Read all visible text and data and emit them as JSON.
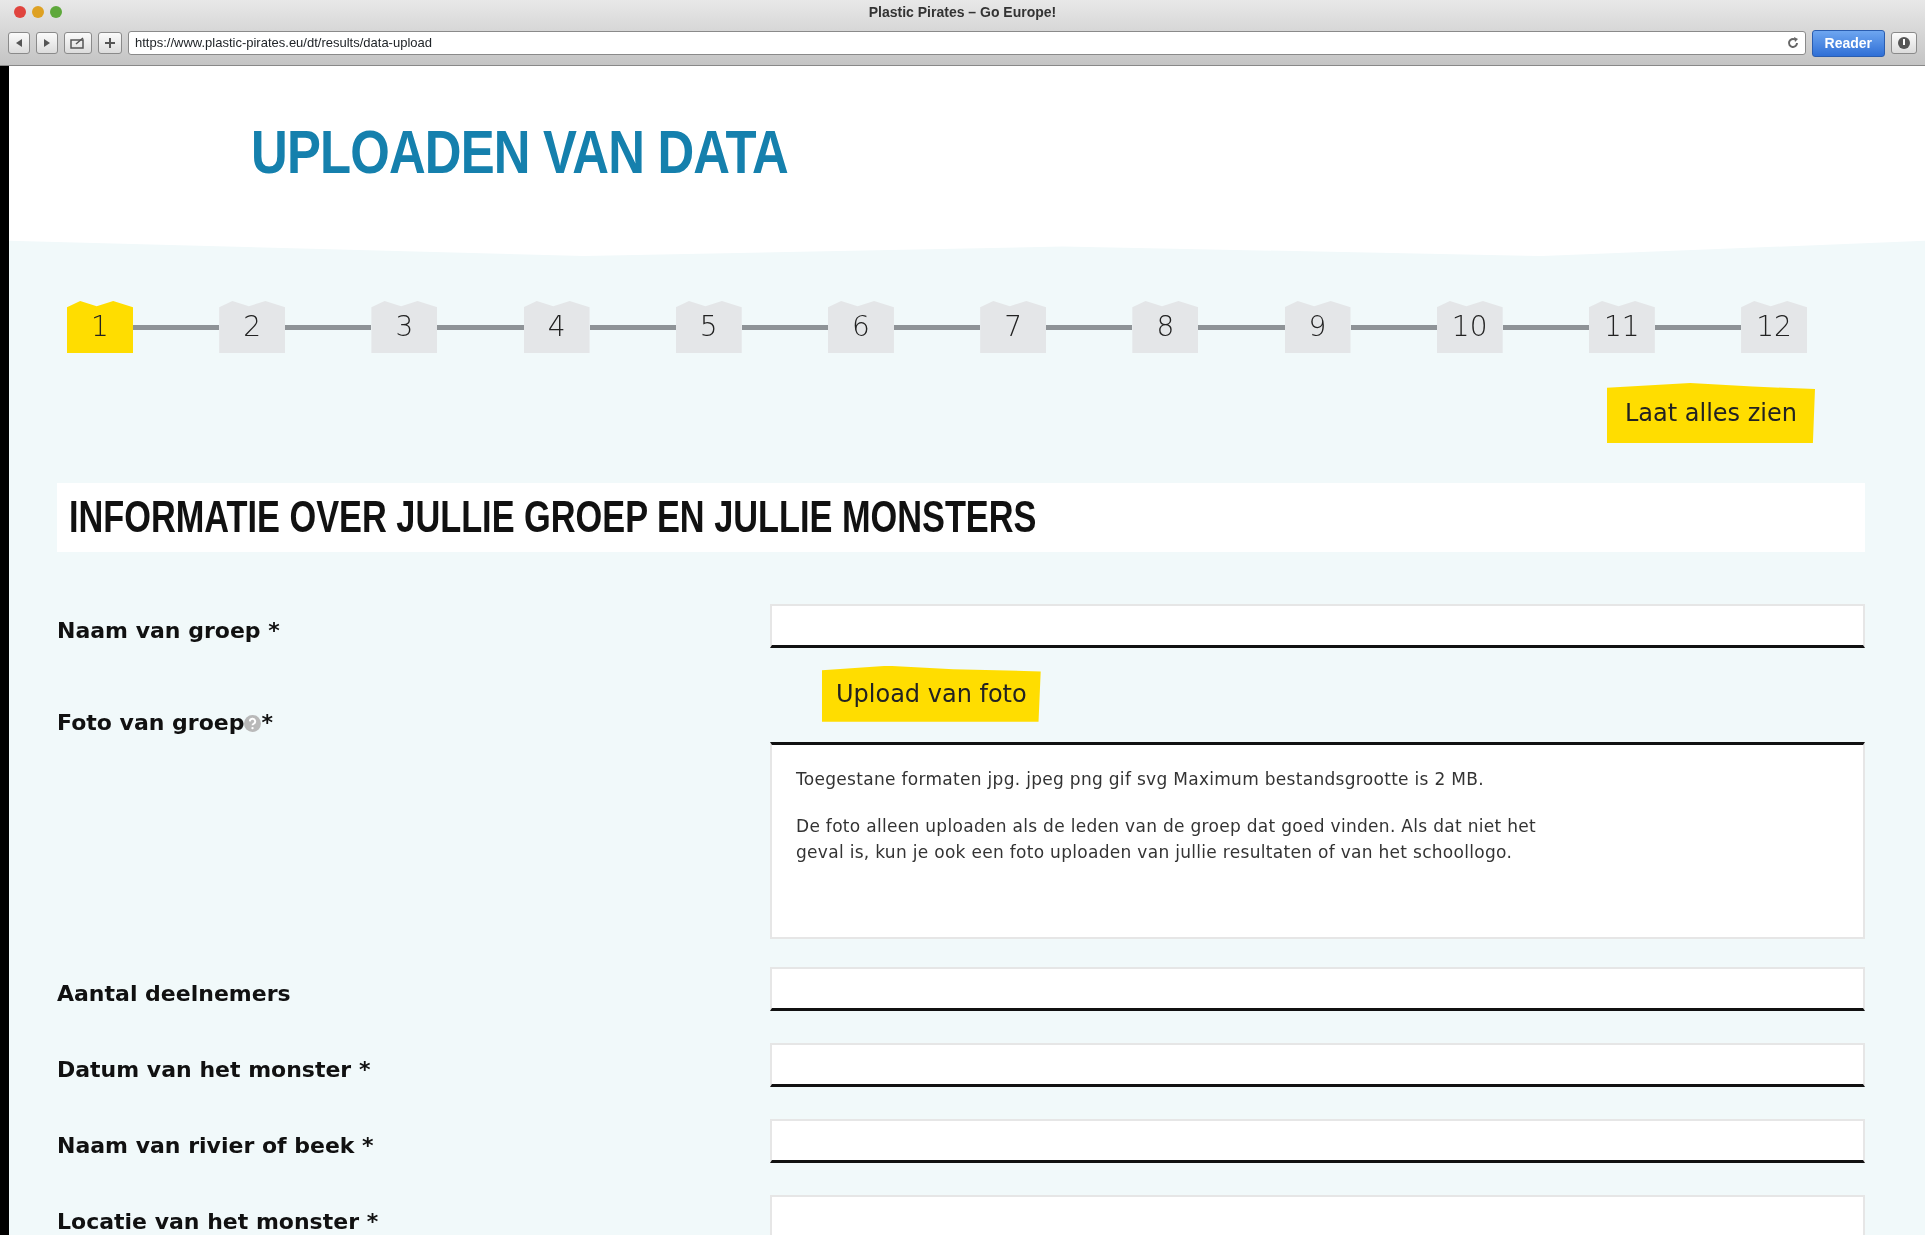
{
  "browser": {
    "title": "Plastic Pirates – Go Europe!",
    "url": "https://www.plastic-pirates.eu/dt/results/data-upload",
    "reader_button": "Reader"
  },
  "page_title": "UPLOADEN VAN DATA",
  "steps": [
    {
      "label": "1",
      "selected": true
    },
    {
      "label": "2",
      "selected": false
    },
    {
      "label": "3",
      "selected": false
    },
    {
      "label": "4",
      "selected": false
    },
    {
      "label": "5",
      "selected": false
    },
    {
      "label": "6",
      "selected": false
    },
    {
      "label": "7",
      "selected": false
    },
    {
      "label": "8",
      "selected": false
    },
    {
      "label": "9",
      "selected": false
    },
    {
      "label": "10",
      "selected": false
    },
    {
      "label": "11",
      "selected": false
    },
    {
      "label": "12",
      "selected": false
    }
  ],
  "show_all_button": "Laat alles zien",
  "section_title": "INFORMATIE OVER JULLIE GROEP EN JULLIE MONSTERS",
  "fields": [
    {
      "kind": "text",
      "label": "Naam van groep *"
    },
    {
      "kind": "upload",
      "label": "Foto van groep",
      "after_help": "*",
      "button": "Upload van foto",
      "hints": [
        "Toegestane formaten jpg. jpeg png gif svg Maximum bestandsgrootte is 2 MB.",
        "De foto alleen uploaden als de leden van de groep dat goed vinden. Als dat niet het geval is, kun je ook een foto uploaden van jullie resultaten of van het schoollogo."
      ]
    },
    {
      "kind": "text",
      "label": "Aantal deelnemers"
    },
    {
      "kind": "text",
      "label": "Datum van het monster *"
    },
    {
      "kind": "text",
      "label": "Naam van rivier of beek *"
    },
    {
      "kind": "text",
      "label": "Locatie van het monster *"
    }
  ]
}
